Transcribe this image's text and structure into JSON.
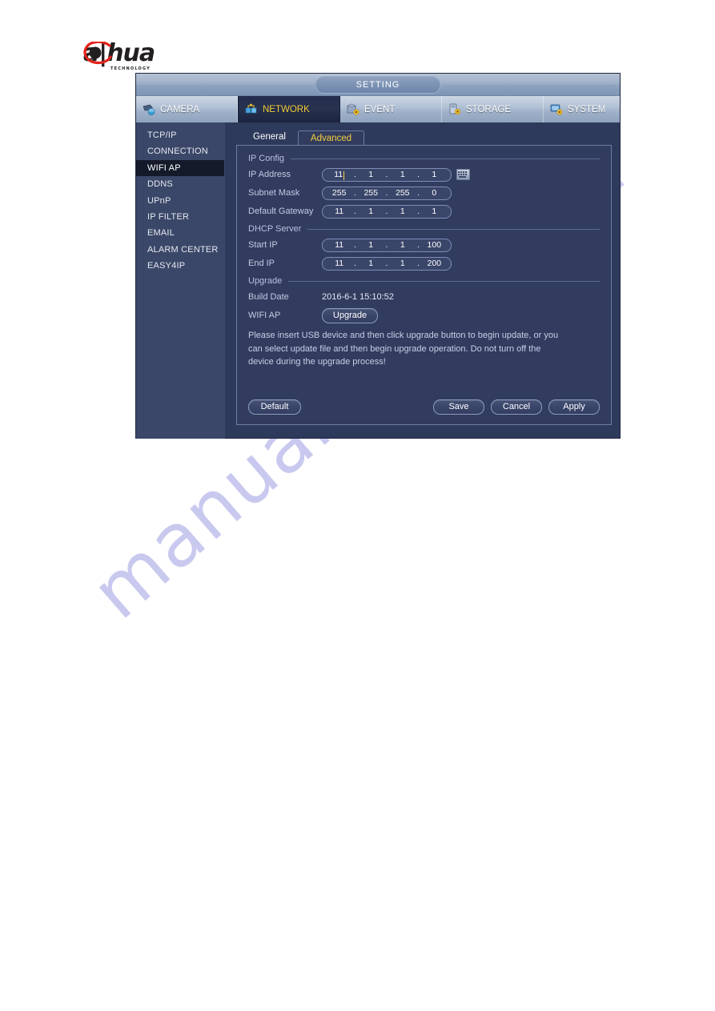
{
  "watermark": {
    "text": "manualshive.com"
  },
  "logo": {
    "wordmark": "a|hua",
    "tagline": "TECHNOLOGY",
    "alt": "dahua-technology-logo"
  },
  "dialog": {
    "title": "SETTING",
    "nav_tabs": [
      {
        "label": "CAMERA",
        "icon": "camera-icon",
        "active": false
      },
      {
        "label": "NETWORK",
        "icon": "network-icon",
        "active": true
      },
      {
        "label": "EVENT",
        "icon": "event-icon",
        "active": false
      },
      {
        "label": "STORAGE",
        "icon": "storage-icon",
        "active": false
      },
      {
        "label": "SYSTEM",
        "icon": "system-icon",
        "active": false
      }
    ],
    "sidebar": {
      "items": [
        {
          "label": "TCP/IP",
          "active": false
        },
        {
          "label": "CONNECTION",
          "active": false
        },
        {
          "label": "WIFI AP",
          "active": true
        },
        {
          "label": "DDNS",
          "active": false
        },
        {
          "label": "UPnP",
          "active": false
        },
        {
          "label": "IP FILTER",
          "active": false
        },
        {
          "label": "EMAIL",
          "active": false
        },
        {
          "label": "ALARM CENTER",
          "active": false
        },
        {
          "label": "EASY4IP",
          "active": false
        }
      ]
    },
    "tabs": [
      {
        "label": "General",
        "active": false
      },
      {
        "label": "Advanced",
        "active": true
      }
    ],
    "sections": {
      "ip_config": {
        "heading": "IP Config",
        "ip_address": {
          "label": "IP Address",
          "octets": [
            "11",
            "1",
            "1",
            "1"
          ],
          "cursor_after_octet": 0,
          "keyboard_icon": "keyboard-icon"
        },
        "subnet_mask": {
          "label": "Subnet Mask",
          "octets": [
            "255",
            "255",
            "255",
            "0"
          ]
        },
        "default_gateway": {
          "label": "Default Gateway",
          "octets": [
            "11",
            "1",
            "1",
            "1"
          ]
        }
      },
      "dhcp_server": {
        "heading": "DHCP Server",
        "start_ip": {
          "label": "Start IP",
          "octets": [
            "11",
            "1",
            "1",
            "100"
          ]
        },
        "end_ip": {
          "label": "End IP",
          "octets": [
            "11",
            "1",
            "1",
            "200"
          ]
        }
      },
      "upgrade": {
        "heading": "Upgrade",
        "build_date": {
          "label": "Build Date",
          "value": "2016-6-1 15:10:52"
        },
        "wifi_ap": {
          "label": "WIFI AP",
          "button_label": "Upgrade"
        },
        "help_text": "Please insert USB device and then click upgrade button to begin update, or you can select update file and then begin upgrade operation. Do not turn off the device during the upgrade process!"
      }
    },
    "buttons": {
      "default": "Default",
      "save": "Save",
      "cancel": "Cancel",
      "apply": "Apply"
    }
  },
  "colors": {
    "accent_yellow": "#f7cf3d",
    "panel_bg": "#313c5e",
    "dialog_bg": "#2e3a5c",
    "sidebar_bg": "#3b4768",
    "sidebar_active": "#151a2a",
    "border": "#6e7ba3",
    "watermark": "#c9c9ef"
  }
}
